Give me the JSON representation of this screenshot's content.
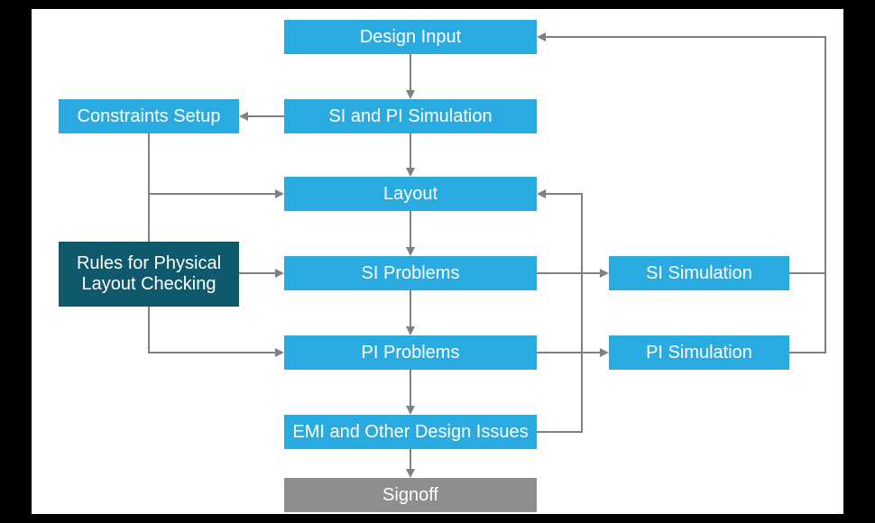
{
  "boxes": {
    "design_input": {
      "label": "Design Input"
    },
    "si_pi_sim": {
      "label": "SI and PI Simulation"
    },
    "constraints_setup": {
      "label": "Constraints Setup"
    },
    "layout": {
      "label": "Layout"
    },
    "rules_phys": {
      "label": "Rules for Physical\nLayout Checking"
    },
    "si_problems": {
      "label": "SI Problems"
    },
    "si_simulation": {
      "label": "SI Simulation"
    },
    "pi_problems": {
      "label": "PI Problems"
    },
    "pi_simulation": {
      "label": "PI Simulation"
    },
    "emi_issues": {
      "label": "EMI and Other Design Issues"
    },
    "signoff": {
      "label": "Signoff"
    }
  },
  "colors": {
    "blue": "#29abe2",
    "dark": "#0e5a6c",
    "gray": "#8e8e8e",
    "arrow": "#808080"
  }
}
